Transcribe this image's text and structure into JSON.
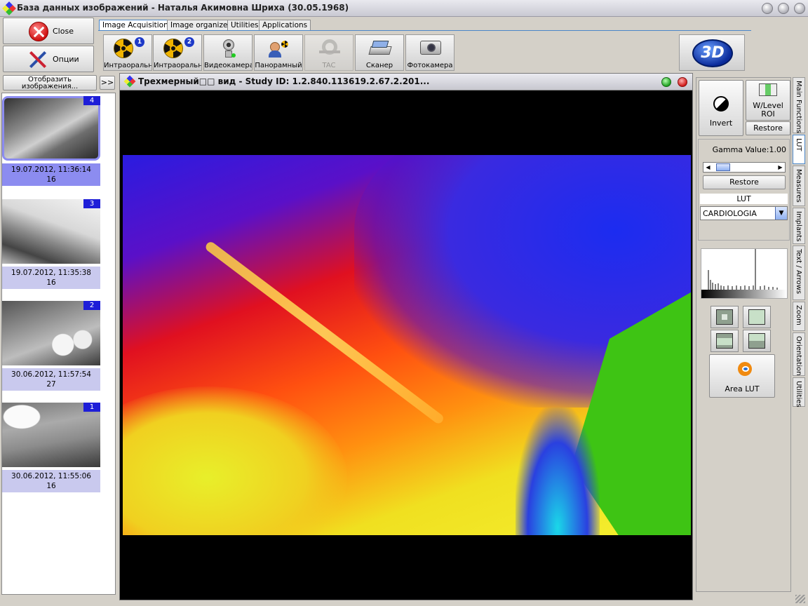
{
  "window": {
    "title": "База данных изображений - Наталья Акимовна  Шриха  (30.05.1968)"
  },
  "left_buttons": {
    "close_label": "Close",
    "options_label": "Опции",
    "show_images_label": "Отобразить изображения...",
    "expand_label": ">>"
  },
  "tabs": [
    {
      "label": "Image Acquisition",
      "active": true
    },
    {
      "label": "Image organizer",
      "active": false
    },
    {
      "label": "Utilities",
      "active": false
    },
    {
      "label": "Applications",
      "active": false
    }
  ],
  "toolbar": [
    {
      "label": "Интраоральный",
      "icon": "radiation-icon",
      "badge": "1"
    },
    {
      "label": "Интраоральный",
      "icon": "radiation-icon",
      "badge": "2"
    },
    {
      "label": "Видеокамера",
      "icon": "video-camera-icon"
    },
    {
      "label": "Панорамный",
      "icon": "panoramic-icon"
    },
    {
      "label": "TAC",
      "icon": "ct-scanner-icon",
      "disabled": true
    },
    {
      "label": "Сканер",
      "icon": "scanner-icon"
    },
    {
      "label": "Фотокамера",
      "icon": "photo-camera-icon"
    }
  ],
  "three_d_label": "3D",
  "thumbnails": [
    {
      "badge": "4",
      "date": "19.07.2012, 11:36:14",
      "count": "16",
      "selected": true
    },
    {
      "badge": "3",
      "date": "19.07.2012, 11:35:38",
      "count": "16",
      "selected": false
    },
    {
      "badge": "2",
      "date": "30.06.2012, 11:57:54",
      "count": "27",
      "selected": false
    },
    {
      "badge": "1",
      "date": "30.06.2012, 11:55:06",
      "count": "16",
      "selected": false
    }
  ],
  "viewer": {
    "title": "Трехмерный□□ вид - Study ID: 1.2.840.113619.2.67.2.201..."
  },
  "right_panel": {
    "invert_label": "Invert",
    "wlevel_label_1": "W/Level",
    "wlevel_label_2": "ROI",
    "restore_label": "Restore",
    "gamma_label": "Gamma Value:1.00",
    "gamma_restore_label": "Restore",
    "lut_title": "LUT",
    "lut_selected": "CARDIOLOGIA",
    "area_lut_label": "Area LUT"
  },
  "side_tabs": [
    "Main Functions",
    "LUT",
    "Measures",
    "Implants",
    "Text / Arrows",
    "Zoom",
    "Orientation",
    "Utilities"
  ],
  "colors": {
    "selection": "#8c8cf0",
    "caption": "#c9c9ee",
    "badge": "#1e1ed8",
    "accent_tab": "#4a86c8"
  }
}
